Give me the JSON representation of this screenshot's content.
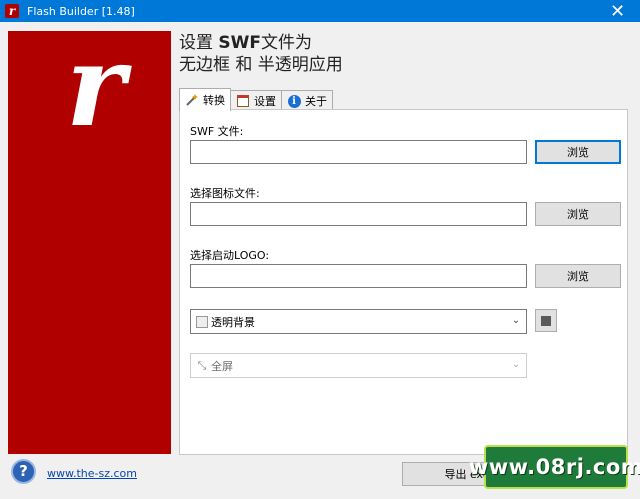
{
  "window": {
    "title": "Flash Builder [1.48]",
    "close_glyph": "✕"
  },
  "brand": {
    "letter": "r",
    "color": "#b00000"
  },
  "headline": {
    "line1_pre": "设置 ",
    "line1_bold": "SWF",
    "line1_post": "文件为",
    "line2": "无边框 和 半透明应用"
  },
  "tabs": [
    {
      "label": "转换",
      "icon": "wand-icon"
    },
    {
      "label": "设置",
      "icon": "settings-icon"
    },
    {
      "label": "关于",
      "icon": "info-icon"
    }
  ],
  "convert": {
    "swf_label": "SWF 文件:",
    "swf_value": "",
    "icon_label": "选择图标文件:",
    "icon_value": "",
    "logo_label": "选择启动LOGO:",
    "logo_value": "",
    "browse_label": "浏览",
    "background_option": "透明背景",
    "window_mode_option": "全屏"
  },
  "footer": {
    "site_link": "www.the-sz.com",
    "export_label": "导出 exe"
  },
  "watermark": "www.08rj.com",
  "colors": {
    "titlebar": "#0078d7",
    "accent": "#b00000",
    "link": "#0645ad"
  }
}
